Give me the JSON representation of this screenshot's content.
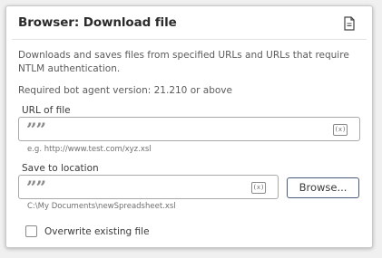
{
  "panel": {
    "title": "Browser: Download file",
    "description": "Downloads and saves files from specified URLs and URLs that require NTLM authentication.",
    "required_version": "Required bot agent version: 21.210 or above"
  },
  "url_field": {
    "label": "URL of file",
    "value": "",
    "hint": "e.g. http://www.test.com/xyz.xsl",
    "quote_icon": "””",
    "var_icon": "(x)"
  },
  "save_field": {
    "label": "Save to location",
    "value": "",
    "hint": "C:\\My Documents\\newSpreadsheet.xsl",
    "quote_icon": "””",
    "var_icon": "(x)",
    "browse_label": "Browse..."
  },
  "overwrite": {
    "label": "Overwrite existing file",
    "checked": false
  },
  "colors": {
    "panel_bg": "#ffffff",
    "page_bg": "#f0f0f0",
    "button_border": "#4a5a7a",
    "field_border": "#a9a9a9"
  }
}
